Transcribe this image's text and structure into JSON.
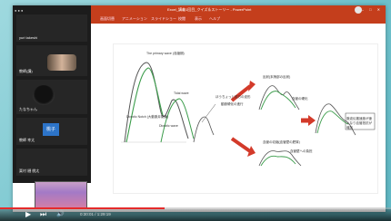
{
  "app": {
    "window_title": "Excel_講義1回目_クイズ＆ストーリー - PowerPoint",
    "accent": "#c43e1c"
  },
  "ribbon_tabs": [
    "ファイル",
    "ホーム",
    "挿入",
    "デザイン",
    "画面切替",
    "アニメーション",
    "スライドショー",
    "校閲",
    "表示",
    "ヘルプ"
  ],
  "zoom": {
    "participants": [
      {
        "name": "yuri takeshi"
      },
      {
        "name": "教師(講)"
      },
      {
        "name": "たなちゃん"
      },
      {
        "name": "教師 幸太",
        "badge": "桃子"
      },
      {
        "name": "栗村 樋 桃太"
      }
    ]
  },
  "slide": {
    "labels": {
      "primary": "The primary wave\n(収縮期)",
      "dicrotic_notch": "Dicrotic Notch\n(大動脈弁閉鎖)",
      "tidal": "Tidal wave",
      "dicrotic_wave": "Dicrotic wave",
      "reflection_top": "反射(末梢部の反射)",
      "lowpass": "ほうちょっと前方の波形",
      "effect": "動脈硬化の進行",
      "low_mid": "血管の硬化",
      "peripheral": "血管壁への負担",
      "bottom_left": "血管の収縮(血管壁の肥厚)",
      "right_box": "脈波伝搬速度が速くなり血管抵抗が増加"
    }
  },
  "player": {
    "progress": 0.42,
    "time": "0:30:01 / 1:29:19"
  }
}
